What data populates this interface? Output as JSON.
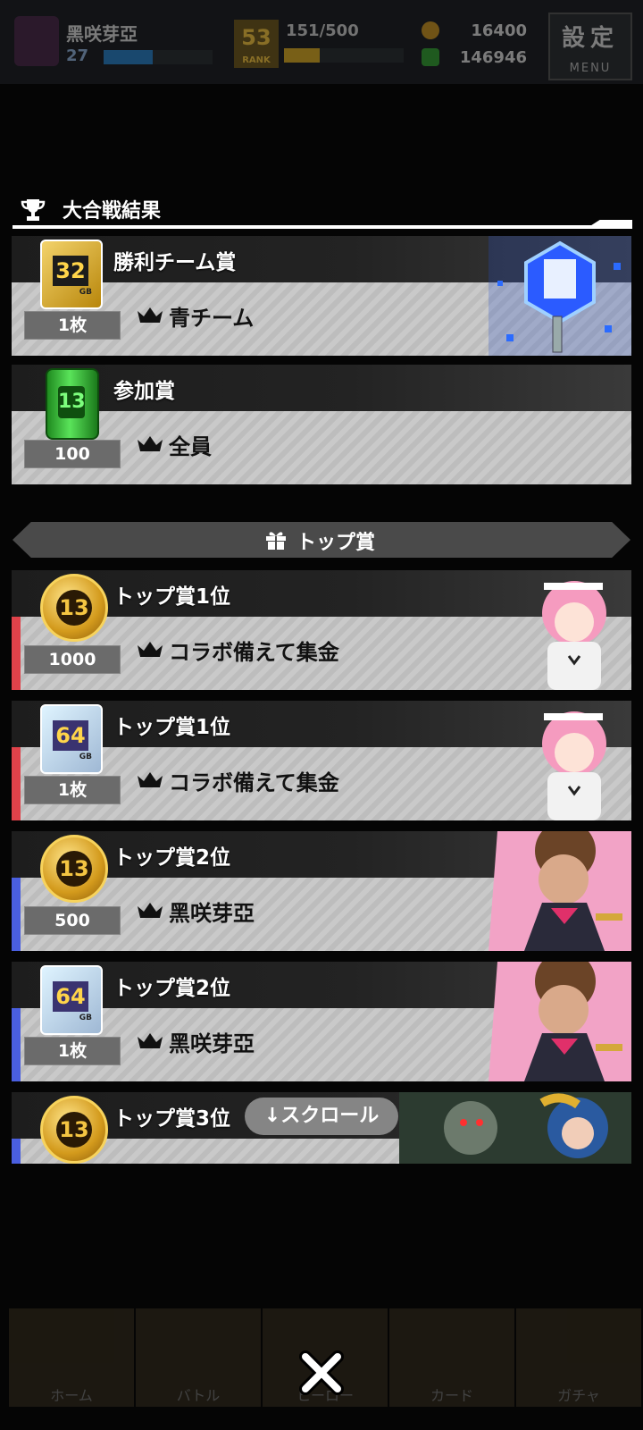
{
  "status_bar": {
    "player_name": "黑咲芽亞",
    "level": "27",
    "level_progress": 0.45,
    "rank": "53",
    "rank_label": "RANK",
    "stamina": "151/500",
    "stamina_progress": 0.3,
    "coins": "16400",
    "gems": "146946",
    "menu_label_top": "設定",
    "menu_label_bottom": "MENU"
  },
  "section": {
    "title": "大合戦結果"
  },
  "team_prizes": [
    {
      "title": "勝利チーム賞",
      "winner": "青チーム",
      "qty": "1枚",
      "item": "sd-32gb",
      "item_text": "32",
      "item_unit": "GB"
    },
    {
      "title": "参加賞",
      "winner": "全員",
      "qty": "100",
      "item": "barrel",
      "item_text": "13"
    }
  ],
  "top_banner": {
    "title": "トップ賞"
  },
  "top_prizes": [
    {
      "title": "トップ賞1位",
      "winner": "コラボ備えて集金",
      "qty": "1000",
      "item": "coin",
      "item_text": "13",
      "accent": "#e0424a"
    },
    {
      "title": "トップ賞1位",
      "winner": "コラボ備えて集金",
      "qty": "1枚",
      "item": "sd-64gb",
      "item_text": "64",
      "item_unit": "GB",
      "accent": "#e0424a"
    },
    {
      "title": "トップ賞2位",
      "winner": "黑咲芽亞",
      "qty": "500",
      "item": "coin",
      "item_text": "13",
      "accent": "#4a5fe0"
    },
    {
      "title": "トップ賞2位",
      "winner": "黑咲芽亞",
      "qty": "1枚",
      "item": "sd-64gb",
      "item_text": "64",
      "item_unit": "GB",
      "accent": "#4a5fe0"
    },
    {
      "title": "トップ賞3位",
      "item": "coin",
      "item_text": "13",
      "accent": "#4a5fe0"
    }
  ],
  "scroll_hint": "↓スクロール",
  "bottom_nav": [
    "ホーム",
    "バトル",
    "ヒーロー",
    "カード",
    "ガチャ"
  ],
  "colors": {
    "accent_red": "#e0424a",
    "accent_blue": "#4a5fe0"
  }
}
